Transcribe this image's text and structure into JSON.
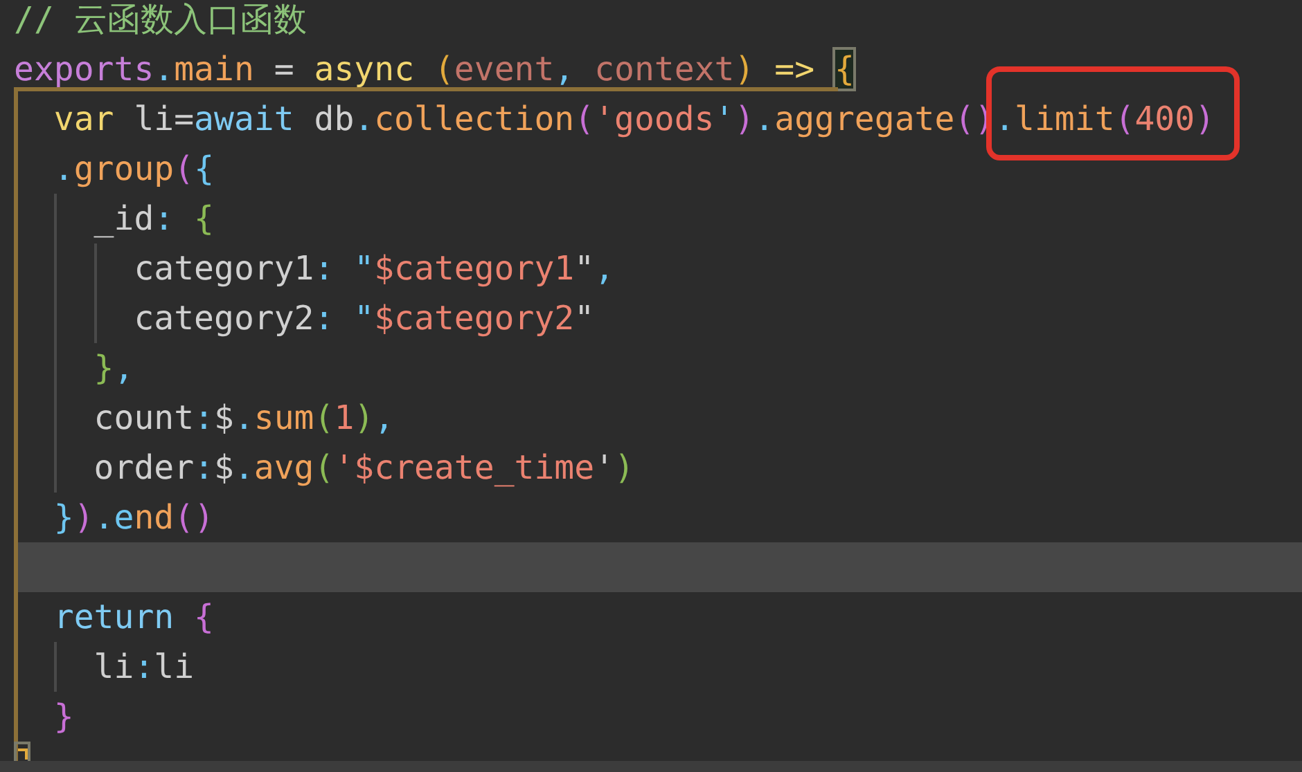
{
  "editor": {
    "lines": [
      {
        "current": false,
        "tokens": [
          {
            "text": "// 云函数入口函数",
            "kind": "comment"
          }
        ]
      },
      {
        "current": false,
        "tokens": [
          {
            "text": "exports",
            "kind": "object"
          },
          {
            "text": ".",
            "kind": "punct"
          },
          {
            "text": "main",
            "kind": "method"
          },
          {
            "text": " = ",
            "kind": "plain"
          },
          {
            "text": "async",
            "kind": "keyword"
          },
          {
            "text": " (",
            "kind": "bracket-gold"
          },
          {
            "text": "event",
            "kind": "param"
          },
          {
            "text": ",",
            "kind": "punct"
          },
          {
            "text": " context",
            "kind": "param"
          },
          {
            "text": ")",
            "kind": "bracket-gold"
          },
          {
            "text": " => ",
            "kind": "keyword"
          },
          {
            "text": "{",
            "kind": "bracket-gold",
            "matched": true
          }
        ]
      },
      {
        "current": false,
        "tokens": [
          {
            "text": "  var",
            "kind": "keyword"
          },
          {
            "text": " li=",
            "kind": "plain"
          },
          {
            "text": "await",
            "kind": "control"
          },
          {
            "text": " db",
            "kind": "plain"
          },
          {
            "text": ".",
            "kind": "punct"
          },
          {
            "text": "collection",
            "kind": "method"
          },
          {
            "text": "(",
            "kind": "bracket-purple"
          },
          {
            "text": "'goods",
            "kind": "string"
          },
          {
            "text": "'",
            "kind": "punct"
          },
          {
            "text": ")",
            "kind": "bracket-purple"
          },
          {
            "text": ".",
            "kind": "punct"
          },
          {
            "text": "aggregate",
            "kind": "method"
          },
          {
            "text": "()",
            "kind": "bracket-purple"
          },
          {
            "text": ".",
            "kind": "punct",
            "framed": true
          },
          {
            "text": "limit",
            "kind": "method",
            "framed": true
          },
          {
            "text": "(",
            "kind": "bracket-purple",
            "framed": true
          },
          {
            "text": "400",
            "kind": "number",
            "framed": true
          },
          {
            "text": ")",
            "kind": "bracket-purple",
            "framed": true
          }
        ]
      },
      {
        "current": false,
        "tokens": [
          {
            "text": "  .",
            "kind": "punct"
          },
          {
            "text": "group",
            "kind": "method"
          },
          {
            "text": "(",
            "kind": "bracket-purple"
          },
          {
            "text": "{",
            "kind": "bracket-blue"
          }
        ]
      },
      {
        "current": false,
        "tokens": [
          {
            "text": "    _id",
            "kind": "plain"
          },
          {
            "text": ":",
            "kind": "punct"
          },
          {
            "text": " {",
            "kind": "bracket-green"
          }
        ]
      },
      {
        "current": false,
        "tokens": [
          {
            "text": "      category1",
            "kind": "plain"
          },
          {
            "text": ":",
            "kind": "punct"
          },
          {
            "text": " \"",
            "kind": "punct"
          },
          {
            "text": "$category1",
            "kind": "string"
          },
          {
            "text": "\"",
            "kind": "plain"
          },
          {
            "text": ",",
            "kind": "punct"
          }
        ]
      },
      {
        "current": false,
        "tokens": [
          {
            "text": "      category2",
            "kind": "plain"
          },
          {
            "text": ":",
            "kind": "punct"
          },
          {
            "text": " \"",
            "kind": "punct"
          },
          {
            "text": "$category2",
            "kind": "string"
          },
          {
            "text": "\"",
            "kind": "plain"
          }
        ]
      },
      {
        "current": false,
        "tokens": [
          {
            "text": "    }",
            "kind": "bracket-green"
          },
          {
            "text": ",",
            "kind": "punct"
          }
        ]
      },
      {
        "current": false,
        "tokens": [
          {
            "text": "    count",
            "kind": "plain"
          },
          {
            "text": ":",
            "kind": "punct"
          },
          {
            "text": "$",
            "kind": "plain"
          },
          {
            "text": ".",
            "kind": "punct"
          },
          {
            "text": "sum",
            "kind": "method"
          },
          {
            "text": "(",
            "kind": "bracket-green"
          },
          {
            "text": "1",
            "kind": "number"
          },
          {
            "text": ")",
            "kind": "bracket-green"
          },
          {
            "text": ",",
            "kind": "punct"
          }
        ]
      },
      {
        "current": false,
        "tokens": [
          {
            "text": "    order",
            "kind": "plain"
          },
          {
            "text": ":",
            "kind": "punct"
          },
          {
            "text": "$",
            "kind": "plain"
          },
          {
            "text": ".",
            "kind": "punct"
          },
          {
            "text": "avg",
            "kind": "method"
          },
          {
            "text": "(",
            "kind": "bracket-green"
          },
          {
            "text": "'$create_time",
            "kind": "string"
          },
          {
            "text": "'",
            "kind": "plain"
          },
          {
            "text": ")",
            "kind": "bracket-green"
          }
        ]
      },
      {
        "current": false,
        "tokens": [
          {
            "text": "  }",
            "kind": "bracket-blue"
          },
          {
            "text": ")",
            "kind": "bracket-purple"
          },
          {
            "text": ".end",
            "kind": "chain"
          },
          {
            "text": "()",
            "kind": "bracket-purple"
          }
        ]
      },
      {
        "current": true
      },
      {
        "current": false,
        "tokens": [
          {
            "text": "  return ",
            "kind": "control"
          },
          {
            "text": "{",
            "kind": "bracket-purple"
          }
        ]
      },
      {
        "current": false,
        "tokens": [
          {
            "text": "    li",
            "kind": "plain"
          },
          {
            "text": ":",
            "kind": "punct"
          },
          {
            "text": "li",
            "kind": "plain"
          }
        ]
      },
      {
        "current": false,
        "tokens": [
          {
            "text": "  }",
            "kind": "bracket-purple"
          }
        ]
      }
    ]
  }
}
